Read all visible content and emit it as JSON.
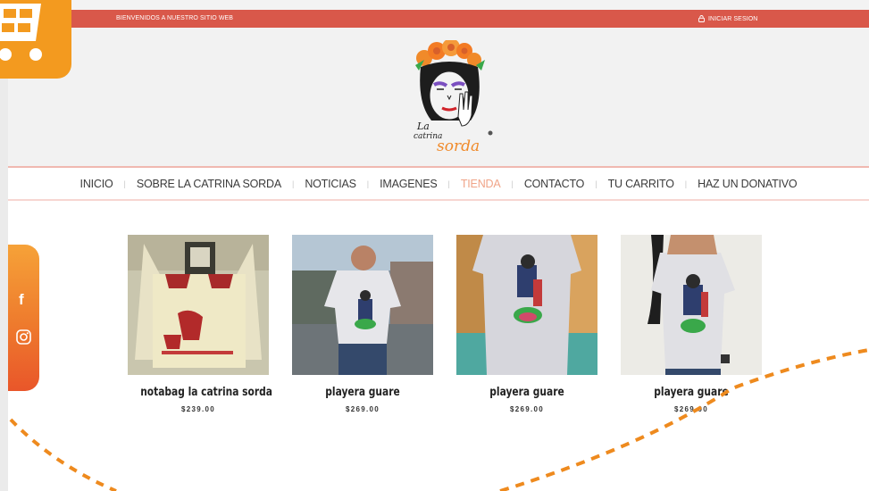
{
  "topbar": {
    "welcome": "BIENVENIDOS A NUESTRO SITIO WEB",
    "login": "INICIAR SESION"
  },
  "logo": {
    "line1": "La",
    "line2": "catrina",
    "line3": "sorda"
  },
  "nav": {
    "items": [
      {
        "label": "INICIO"
      },
      {
        "label": "SOBRE LA CATRINA SORDA"
      },
      {
        "label": "NOTICIAS"
      },
      {
        "label": "IMAGENES"
      },
      {
        "label": "TIENDA",
        "active": true
      },
      {
        "label": "CONTACTO"
      },
      {
        "label": "TU CARRITO"
      },
      {
        "label": "HAZ UN DONATIVO"
      }
    ],
    "separator": "|"
  },
  "products": [
    {
      "name": "notabag la catrina sorda",
      "price": "$239.00"
    },
    {
      "name": "playera guare",
      "price": "$269.00"
    },
    {
      "name": "playera guare",
      "price": "$269.00"
    },
    {
      "name": "playera guare",
      "price": "$269.00"
    }
  ],
  "social": {
    "facebook": "f"
  },
  "colors": {
    "accent": "#d9584a",
    "nav_active": "#f0a488",
    "orange": "#f39a1f"
  }
}
